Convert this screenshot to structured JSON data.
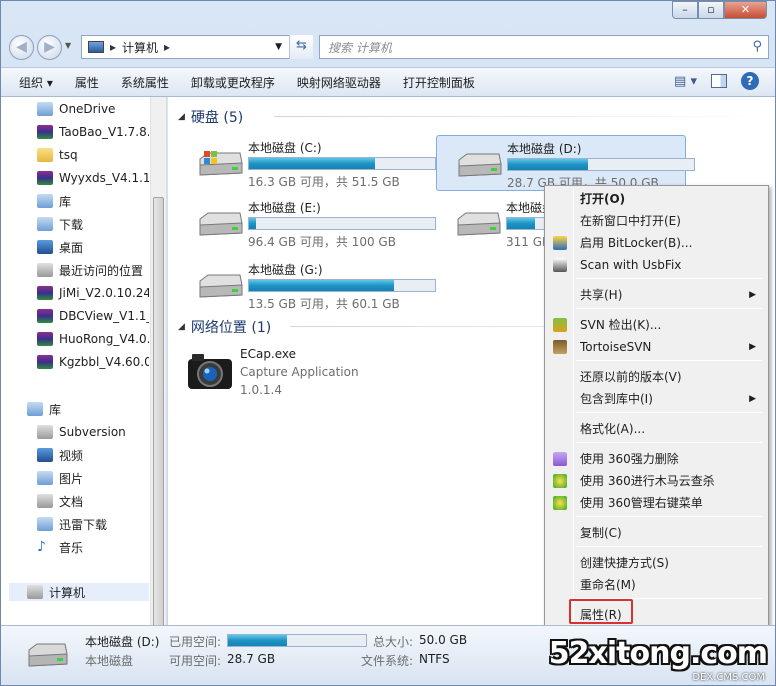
{
  "address": {
    "path_label": "计算机",
    "separator": "▸"
  },
  "search": {
    "placeholder": "搜索 计算机"
  },
  "toolbar": {
    "organize": "组织 ▾",
    "properties": "属性",
    "system_properties": "系统属性",
    "uninstall": "卸载或更改程序",
    "map_drive": "映射网络驱动器",
    "control_panel": "打开控制面板"
  },
  "nav": {
    "items": [
      {
        "label": "OneDrive",
        "icon": "onedrive-icon"
      },
      {
        "label": "TaoBao_V1.7.8.",
        "icon": "rar-archive-icon"
      },
      {
        "label": "tsq",
        "icon": "folder-icon"
      },
      {
        "label": "Wyyxds_V4.1.1.",
        "icon": "rar-archive-icon"
      },
      {
        "label": "库",
        "icon": "library-icon"
      },
      {
        "label": "下载",
        "icon": "downloads-folder-icon"
      },
      {
        "label": "桌面",
        "icon": "desktop-icon"
      },
      {
        "label": "最近访问的位置",
        "icon": "recent-places-icon"
      },
      {
        "label": "JiMi_V2.0.10.24_",
        "icon": "rar-archive-icon"
      },
      {
        "label": "DBCView_V1.1_",
        "icon": "rar-archive-icon"
      },
      {
        "label": "HuoRong_V4.0.",
        "icon": "rar-archive-icon"
      },
      {
        "label": "Kgzbbl_V4.60.0",
        "icon": "rar-archive-icon"
      }
    ],
    "library_header": "库",
    "libraries": [
      {
        "label": "Subversion",
        "icon": "subversion-icon"
      },
      {
        "label": "视频",
        "icon": "video-library-icon"
      },
      {
        "label": "图片",
        "icon": "picture-library-icon"
      },
      {
        "label": "文档",
        "icon": "document-library-icon"
      },
      {
        "label": "迅雷下载",
        "icon": "xunlei-download-icon"
      },
      {
        "label": "音乐",
        "icon": "music-library-icon"
      }
    ],
    "computer": "计算机"
  },
  "groups": {
    "disks": "硬盘 (5)",
    "network": "网络位置 (1)"
  },
  "drives": [
    {
      "name": "本地磁盘 (C:)",
      "free": "16.3 GB 可用，共 51.5 GB",
      "used_fraction": 0.68
    },
    {
      "name": "本地磁盘 (D:)",
      "free": "28.7 GB 可用，共 50.0 GB",
      "used_fraction": 0.43
    },
    {
      "name": "本地磁盘 (E:)",
      "free": "96.4 GB 可用，共 100 GB",
      "used_fraction": 0.04
    },
    {
      "name": "本地磁盘 (F:)",
      "free": "311 GB 可用，共 ...",
      "used_fraction": 0.15
    },
    {
      "name": "本地磁盘 (G:)",
      "free": "13.5 GB 可用，共 60.1 GB",
      "used_fraction": 0.78
    }
  ],
  "network_item": {
    "name": "ECap.exe",
    "desc": "Capture Application",
    "version": "1.0.1.4"
  },
  "context_menu": [
    {
      "label": "打开(O)",
      "bold": true
    },
    {
      "label": "在新窗口中打开(E)"
    },
    {
      "label": "启用 BitLocker(B)...",
      "icon": "bitlocker-shield-icon"
    },
    {
      "label": "Scan with UsbFix",
      "icon": "usbfix-icon"
    },
    {
      "label": "共享(H)",
      "submenu": true
    },
    {
      "label": "SVN 检出(K)...",
      "icon": "svn-checkout-icon"
    },
    {
      "label": "TortoiseSVN",
      "icon": "tortoisesvn-icon",
      "submenu": true
    },
    {
      "label": "还原以前的版本(V)"
    },
    {
      "label": "包含到库中(I)",
      "submenu": true
    },
    {
      "label": "格式化(A)..."
    },
    {
      "label": "使用 360强力删除",
      "icon": "360-delete-icon"
    },
    {
      "label": "使用 360进行木马云查杀",
      "icon": "360-scan-icon"
    },
    {
      "label": "使用 360管理右键菜单",
      "icon": "360-menu-icon"
    },
    {
      "label": "复制(C)"
    },
    {
      "label": "创建快捷方式(S)"
    },
    {
      "label": "重命名(M)"
    },
    {
      "label": "属性(R)"
    }
  ],
  "status": {
    "name": "本地磁盘 (D:)",
    "type": "本地磁盘",
    "used_label": "已用空间:",
    "used_fraction": 0.43,
    "free_label": "可用空间:",
    "free_value": "28.7 GB",
    "total_label": "总大小:",
    "total_value": "50.0 GB",
    "fs_label": "文件系统:",
    "fs_value": "NTFS"
  },
  "watermark": {
    "main": "52xitong.com",
    "sub": "DEX.CMS.COM"
  }
}
